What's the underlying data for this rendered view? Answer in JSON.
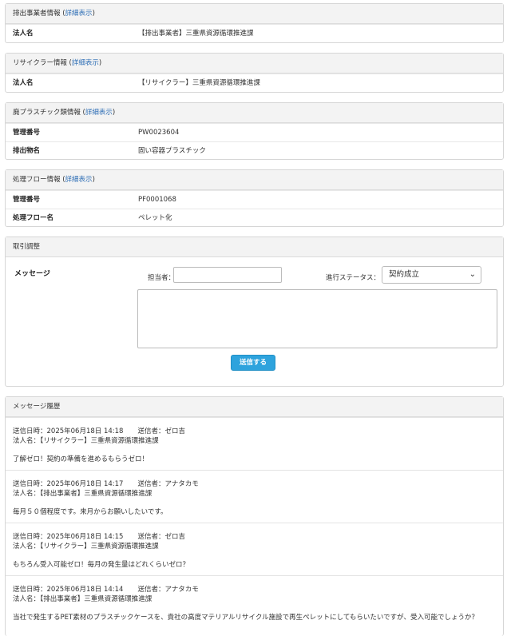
{
  "emitter": {
    "title": "排出事業者情報",
    "detail_link": "詳細表示",
    "rows": [
      {
        "label": "法人名",
        "value": "【排出事業者】三重県資源循環推進課"
      }
    ]
  },
  "recycler": {
    "title": "リサイクラー情報",
    "detail_link": "詳細表示",
    "rows": [
      {
        "label": "法人名",
        "value": "【リサイクラー】三重県資源循環推進課"
      }
    ]
  },
  "plastic": {
    "title": "廃プラスチック類情報",
    "detail_link": "詳細表示",
    "rows": [
      {
        "label": "管理番号",
        "value": "PW0023604"
      },
      {
        "label": "排出物名",
        "value": "固い容器プラスチック"
      }
    ]
  },
  "flow": {
    "title": "処理フロー情報",
    "detail_link": "詳細表示",
    "rows": [
      {
        "label": "管理番号",
        "value": "PF0001068"
      },
      {
        "label": "処理フロー名",
        "value": "ペレット化"
      }
    ]
  },
  "trade": {
    "title": "取引調整",
    "message_label": "メッセージ",
    "tantou_label": "担当者：",
    "tantou_value": "",
    "status_label": "進行ステータス：",
    "status_value": "契約成立",
    "send_label": "送信する"
  },
  "history": {
    "title": "メッセージ履歴",
    "items": [
      {
        "sent": "送信日時：2025年06月18日 14:18",
        "sender": "送信者：ゼロ吉",
        "company": "法人名：【リサイクラー】三重県資源循環推進課",
        "body": "了解ゼロ！契約の準備を進めるもらうゼロ！"
      },
      {
        "sent": "送信日時：2025年06月18日 14:17",
        "sender": "送信者：アナタカモ",
        "company": "法人名：【排出事業者】三重県資源循環推進課",
        "body": "毎月５０個程度です。来月からお願いしたいです。"
      },
      {
        "sent": "送信日時：2025年06月18日 14:15",
        "sender": "送信者：ゼロ吉",
        "company": "法人名：【リサイクラー】三重県資源循環推進課",
        "body": "もちろん受入可能ゼロ！毎月の発生量はどれくらいゼロ？"
      },
      {
        "sent": "送信日時：2025年06月18日 14:14",
        "sender": "送信者：アナタカモ",
        "company": "法人名：【排出事業者】三重県資源循環推進課",
        "body": "当社で発生するPET素材のプラスチックケースを、貴社の高度マテリアルリサイクル施設で再生ペレットにしてもらいたいですが、受入可能でしょうか？"
      }
    ]
  }
}
